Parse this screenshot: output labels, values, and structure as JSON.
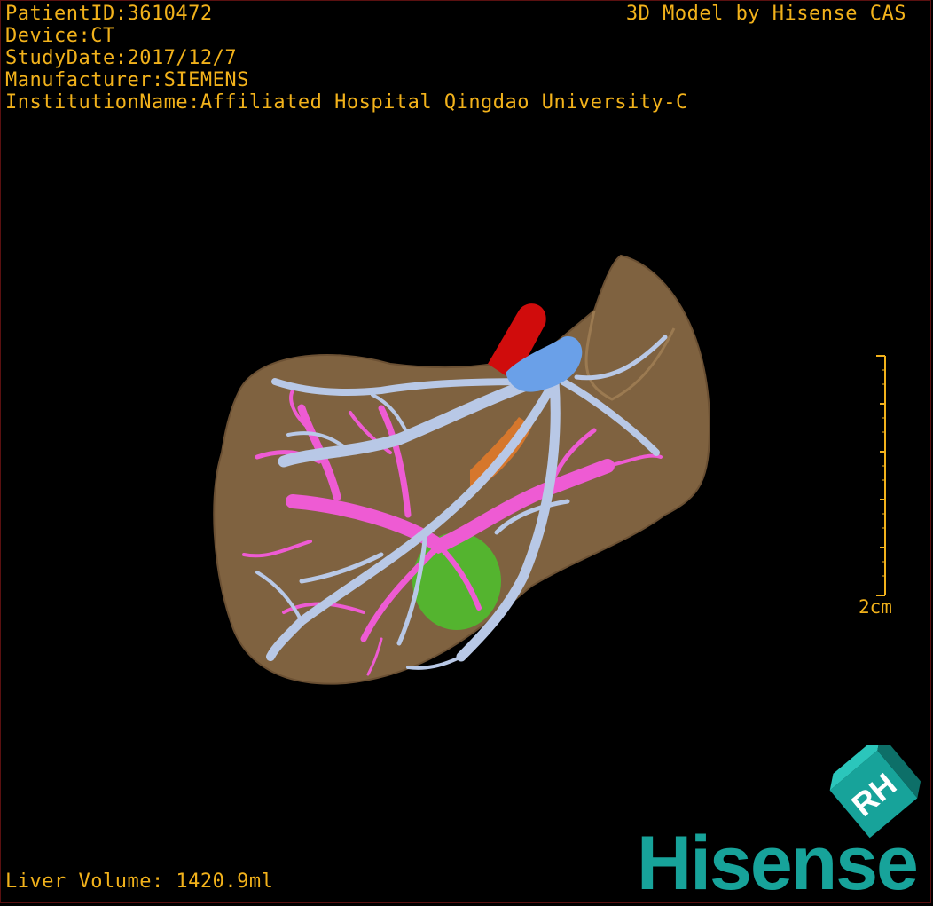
{
  "info": {
    "patient_id": "PatientID:3610472",
    "device": "Device:CT",
    "study_date": "StudyDate:2017/12/7",
    "manufacturer": "Manufacturer:SIEMENS",
    "institution": "InstitutionName:Affiliated Hospital Qingdao University-C"
  },
  "brand_caption": "3D Model by Hisense CAS",
  "scale_bar": {
    "label": "2cm",
    "color": "#f2b21b"
  },
  "liver_volume": "Liver Volume: 1420.9ml",
  "logo": {
    "cube_text": "RH",
    "wordmark": "Hisense",
    "color": "#17a39a"
  },
  "colors": {
    "overlay_text": "#f2b21b",
    "liver": "#8a6a45",
    "hepatic_vein": "#b8c8e6",
    "portal_vein": "#ee5bd3",
    "ivc": "#6aa0e8",
    "aorta": "#d00c0c",
    "tumor": "#52b82e"
  }
}
